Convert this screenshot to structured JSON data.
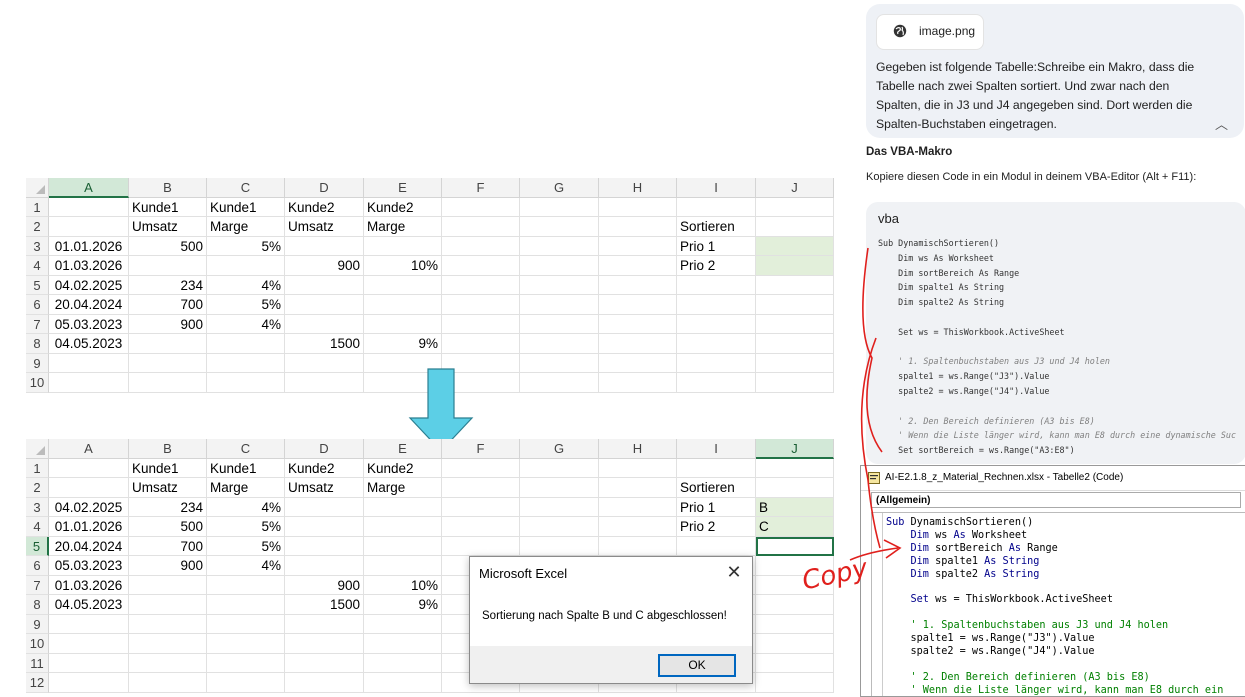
{
  "columns": [
    "A",
    "B",
    "C",
    "D",
    "E",
    "F",
    "G",
    "H",
    "I",
    "J"
  ],
  "sheet_top": {
    "rows": [
      {
        "num": "1",
        "cells": {
          "B": "Kunde1",
          "C": "Kunde1",
          "D": "Kunde2",
          "E": "Kunde2"
        }
      },
      {
        "num": "2",
        "cells": {
          "B": "Umsatz",
          "C": "Marge",
          "D": "Umsatz",
          "E": "Marge",
          "I": "Sortieren"
        }
      },
      {
        "num": "3",
        "cells": {
          "A": "01.01.2026",
          "B": "500",
          "C": "5%",
          "I": "Prio 1"
        }
      },
      {
        "num": "4",
        "cells": {
          "A": "01.03.2026",
          "D": "900",
          "E": "10%",
          "I": "Prio 2"
        }
      },
      {
        "num": "5",
        "cells": {
          "A": "04.02.2025",
          "B": "234",
          "C": "4%"
        }
      },
      {
        "num": "6",
        "cells": {
          "A": "20.04.2024",
          "B": "700",
          "C": "5%"
        }
      },
      {
        "num": "7",
        "cells": {
          "A": "05.03.2023",
          "B": "900",
          "C": "4%"
        }
      },
      {
        "num": "8",
        "cells": {
          "A": "04.05.2023",
          "D": "1500",
          "E": "9%"
        }
      },
      {
        "num": "9",
        "cells": {}
      },
      {
        "num": "10",
        "cells": {}
      }
    ]
  },
  "sheet_bottom": {
    "rows": [
      {
        "num": "1",
        "cells": {
          "B": "Kunde1",
          "C": "Kunde1",
          "D": "Kunde2",
          "E": "Kunde2"
        }
      },
      {
        "num": "2",
        "cells": {
          "B": "Umsatz",
          "C": "Marge",
          "D": "Umsatz",
          "E": "Marge",
          "I": "Sortieren"
        }
      },
      {
        "num": "3",
        "cells": {
          "A": "04.02.2025",
          "B": "234",
          "C": "4%",
          "I": "Prio 1",
          "J": "B"
        }
      },
      {
        "num": "4",
        "cells": {
          "A": "01.01.2026",
          "B": "500",
          "C": "5%",
          "I": "Prio 2",
          "J": "C"
        }
      },
      {
        "num": "5",
        "cells": {
          "A": "20.04.2024",
          "B": "700",
          "C": "5%"
        }
      },
      {
        "num": "6",
        "cells": {
          "A": "05.03.2023",
          "B": "900",
          "C": "4%"
        }
      },
      {
        "num": "7",
        "cells": {
          "A": "01.03.2026",
          "D": "900",
          "E": "10%"
        }
      },
      {
        "num": "8",
        "cells": {
          "A": "04.05.2023",
          "D": "1500",
          "E": "9%"
        }
      },
      {
        "num": "9",
        "cells": {}
      },
      {
        "num": "10",
        "cells": {}
      },
      {
        "num": "11",
        "cells": {}
      },
      {
        "num": "12",
        "cells": {}
      }
    ]
  },
  "dialog": {
    "title": "Microsoft Excel",
    "close": "✕",
    "message": "Sortierung nach Spalte B und C abgeschlossen!",
    "ok": "OK"
  },
  "chat": {
    "attachment_name": "image.png",
    "prompt": "Gegeben ist folgende Tabelle:Schreibe ein Makro, dass die Tabelle nach zwei Spalten sortiert. Und zwar nach den Spalten, die in J3 und J4 angegeben sind. Dort werden die Spalten-Buchstaben eingetragen.",
    "heading": "Das VBA-Makro",
    "instruction": "Kopiere diesen Code in ein Modul in deinem VBA-Editor (Alt + F11):",
    "code_lang": "vba",
    "code_lines": [
      {
        "t": "Sub DynamischSortieren()",
        "c": false
      },
      {
        "t": "    Dim ws As Worksheet",
        "c": false
      },
      {
        "t": "    Dim sortBereich As Range",
        "c": false
      },
      {
        "t": "    Dim spalte1 As String",
        "c": false
      },
      {
        "t": "    Dim spalte2 As String",
        "c": false
      },
      {
        "t": "",
        "c": false
      },
      {
        "t": "    Set ws = ThisWorkbook.ActiveSheet",
        "c": false
      },
      {
        "t": "",
        "c": false
      },
      {
        "t": "    ' 1. Spaltenbuchstaben aus J3 und J4 holen",
        "c": true
      },
      {
        "t": "    spalte1 = ws.Range(\"J3\").Value",
        "c": false
      },
      {
        "t": "    spalte2 = ws.Range(\"J4\").Value",
        "c": false
      },
      {
        "t": "",
        "c": false
      },
      {
        "t": "    ' 2. Den Bereich definieren (A3 bis E8)",
        "c": true
      },
      {
        "t": "    ' Wenn die Liste länger wird, kann man E8 durch eine dynamische Suc",
        "c": true
      },
      {
        "t": "    Set sortBereich = ws.Range(\"A3:E8\")",
        "c": false
      }
    ]
  },
  "vbe": {
    "title": "AI-E2.1.8_z_Material_Rechnen.xlsx - Tabelle2 (Code)",
    "combo": "(Allgemein)",
    "lines": [
      [
        {
          "k": "Sub ",
          "s": "kw"
        },
        {
          "k": "DynamischSortieren()",
          "s": ""
        }
      ],
      [
        {
          "k": "    Dim ",
          "s": "kw"
        },
        {
          "k": "ws ",
          "s": ""
        },
        {
          "k": "As ",
          "s": "kw"
        },
        {
          "k": "Worksheet",
          "s": ""
        }
      ],
      [
        {
          "k": "    Dim ",
          "s": "kw"
        },
        {
          "k": "sortBereich ",
          "s": ""
        },
        {
          "k": "As ",
          "s": "kw"
        },
        {
          "k": "Range",
          "s": ""
        }
      ],
      [
        {
          "k": "    Dim ",
          "s": "kw"
        },
        {
          "k": "spalte1 ",
          "s": ""
        },
        {
          "k": "As String",
          "s": "kw"
        }
      ],
      [
        {
          "k": "    Dim ",
          "s": "kw"
        },
        {
          "k": "spalte2 ",
          "s": ""
        },
        {
          "k": "As String",
          "s": "kw"
        }
      ],
      [
        {
          "k": "",
          "s": ""
        }
      ],
      [
        {
          "k": "    Set ",
          "s": "kw"
        },
        {
          "k": "ws = ThisWorkbook.ActiveSheet",
          "s": ""
        }
      ],
      [
        {
          "k": "",
          "s": ""
        }
      ],
      [
        {
          "k": "    ' 1. Spaltenbuchstaben aus J3 und J4 holen",
          "s": "vcmt"
        }
      ],
      [
        {
          "k": "    spalte1 = ws.Range(\"J3\").Value",
          "s": ""
        }
      ],
      [
        {
          "k": "    spalte2 = ws.Range(\"J4\").Value",
          "s": ""
        }
      ],
      [
        {
          "k": "",
          "s": ""
        }
      ],
      [
        {
          "k": "    ' 2. Den Bereich definieren (A3 bis E8)",
          "s": "vcmt"
        }
      ],
      [
        {
          "k": "    ' Wenn die Liste länger wird, kann man E8 durch ein",
          "s": "vcmt"
        }
      ]
    ]
  },
  "annotation": {
    "copy_text": "Copy",
    "color": "#e0201d"
  },
  "colors": {
    "excel_green": "#217346",
    "arrow": "#5ccfe6",
    "highlight": "#e2efda"
  }
}
